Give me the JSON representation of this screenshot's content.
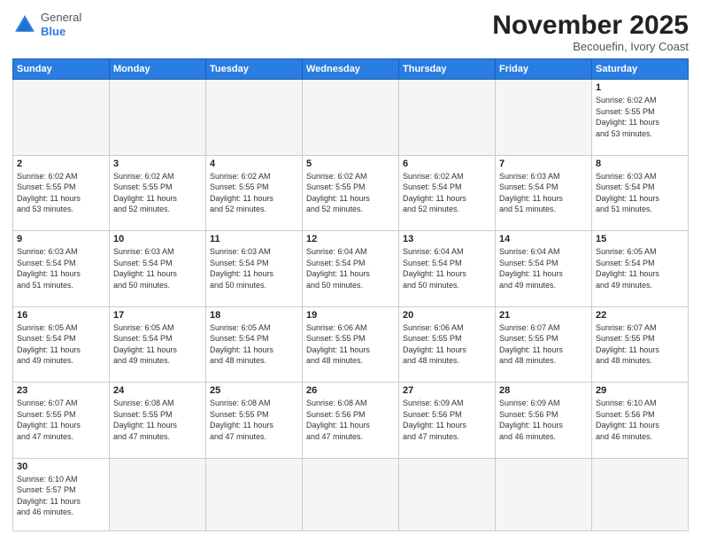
{
  "header": {
    "logo_general": "General",
    "logo_blue": "Blue",
    "month_title": "November 2025",
    "location": "Becouefin, Ivory Coast"
  },
  "days_of_week": [
    "Sunday",
    "Monday",
    "Tuesday",
    "Wednesday",
    "Thursday",
    "Friday",
    "Saturday"
  ],
  "weeks": [
    [
      {
        "day": "",
        "info": ""
      },
      {
        "day": "",
        "info": ""
      },
      {
        "day": "",
        "info": ""
      },
      {
        "day": "",
        "info": ""
      },
      {
        "day": "",
        "info": ""
      },
      {
        "day": "",
        "info": ""
      },
      {
        "day": "1",
        "info": "Sunrise: 6:02 AM\nSunset: 5:55 PM\nDaylight: 11 hours\nand 53 minutes."
      }
    ],
    [
      {
        "day": "2",
        "info": "Sunrise: 6:02 AM\nSunset: 5:55 PM\nDaylight: 11 hours\nand 53 minutes."
      },
      {
        "day": "3",
        "info": "Sunrise: 6:02 AM\nSunset: 5:55 PM\nDaylight: 11 hours\nand 52 minutes."
      },
      {
        "day": "4",
        "info": "Sunrise: 6:02 AM\nSunset: 5:55 PM\nDaylight: 11 hours\nand 52 minutes."
      },
      {
        "day": "5",
        "info": "Sunrise: 6:02 AM\nSunset: 5:55 PM\nDaylight: 11 hours\nand 52 minutes."
      },
      {
        "day": "6",
        "info": "Sunrise: 6:02 AM\nSunset: 5:54 PM\nDaylight: 11 hours\nand 52 minutes."
      },
      {
        "day": "7",
        "info": "Sunrise: 6:03 AM\nSunset: 5:54 PM\nDaylight: 11 hours\nand 51 minutes."
      },
      {
        "day": "8",
        "info": "Sunrise: 6:03 AM\nSunset: 5:54 PM\nDaylight: 11 hours\nand 51 minutes."
      }
    ],
    [
      {
        "day": "9",
        "info": "Sunrise: 6:03 AM\nSunset: 5:54 PM\nDaylight: 11 hours\nand 51 minutes."
      },
      {
        "day": "10",
        "info": "Sunrise: 6:03 AM\nSunset: 5:54 PM\nDaylight: 11 hours\nand 50 minutes."
      },
      {
        "day": "11",
        "info": "Sunrise: 6:03 AM\nSunset: 5:54 PM\nDaylight: 11 hours\nand 50 minutes."
      },
      {
        "day": "12",
        "info": "Sunrise: 6:04 AM\nSunset: 5:54 PM\nDaylight: 11 hours\nand 50 minutes."
      },
      {
        "day": "13",
        "info": "Sunrise: 6:04 AM\nSunset: 5:54 PM\nDaylight: 11 hours\nand 50 minutes."
      },
      {
        "day": "14",
        "info": "Sunrise: 6:04 AM\nSunset: 5:54 PM\nDaylight: 11 hours\nand 49 minutes."
      },
      {
        "day": "15",
        "info": "Sunrise: 6:05 AM\nSunset: 5:54 PM\nDaylight: 11 hours\nand 49 minutes."
      }
    ],
    [
      {
        "day": "16",
        "info": "Sunrise: 6:05 AM\nSunset: 5:54 PM\nDaylight: 11 hours\nand 49 minutes."
      },
      {
        "day": "17",
        "info": "Sunrise: 6:05 AM\nSunset: 5:54 PM\nDaylight: 11 hours\nand 49 minutes."
      },
      {
        "day": "18",
        "info": "Sunrise: 6:05 AM\nSunset: 5:54 PM\nDaylight: 11 hours\nand 48 minutes."
      },
      {
        "day": "19",
        "info": "Sunrise: 6:06 AM\nSunset: 5:55 PM\nDaylight: 11 hours\nand 48 minutes."
      },
      {
        "day": "20",
        "info": "Sunrise: 6:06 AM\nSunset: 5:55 PM\nDaylight: 11 hours\nand 48 minutes."
      },
      {
        "day": "21",
        "info": "Sunrise: 6:07 AM\nSunset: 5:55 PM\nDaylight: 11 hours\nand 48 minutes."
      },
      {
        "day": "22",
        "info": "Sunrise: 6:07 AM\nSunset: 5:55 PM\nDaylight: 11 hours\nand 48 minutes."
      }
    ],
    [
      {
        "day": "23",
        "info": "Sunrise: 6:07 AM\nSunset: 5:55 PM\nDaylight: 11 hours\nand 47 minutes."
      },
      {
        "day": "24",
        "info": "Sunrise: 6:08 AM\nSunset: 5:55 PM\nDaylight: 11 hours\nand 47 minutes."
      },
      {
        "day": "25",
        "info": "Sunrise: 6:08 AM\nSunset: 5:55 PM\nDaylight: 11 hours\nand 47 minutes."
      },
      {
        "day": "26",
        "info": "Sunrise: 6:08 AM\nSunset: 5:56 PM\nDaylight: 11 hours\nand 47 minutes."
      },
      {
        "day": "27",
        "info": "Sunrise: 6:09 AM\nSunset: 5:56 PM\nDaylight: 11 hours\nand 47 minutes."
      },
      {
        "day": "28",
        "info": "Sunrise: 6:09 AM\nSunset: 5:56 PM\nDaylight: 11 hours\nand 46 minutes."
      },
      {
        "day": "29",
        "info": "Sunrise: 6:10 AM\nSunset: 5:56 PM\nDaylight: 11 hours\nand 46 minutes."
      }
    ],
    [
      {
        "day": "30",
        "info": "Sunrise: 6:10 AM\nSunset: 5:57 PM\nDaylight: 11 hours\nand 46 minutes."
      },
      {
        "day": "",
        "info": ""
      },
      {
        "day": "",
        "info": ""
      },
      {
        "day": "",
        "info": ""
      },
      {
        "day": "",
        "info": ""
      },
      {
        "day": "",
        "info": ""
      },
      {
        "day": "",
        "info": ""
      }
    ]
  ]
}
